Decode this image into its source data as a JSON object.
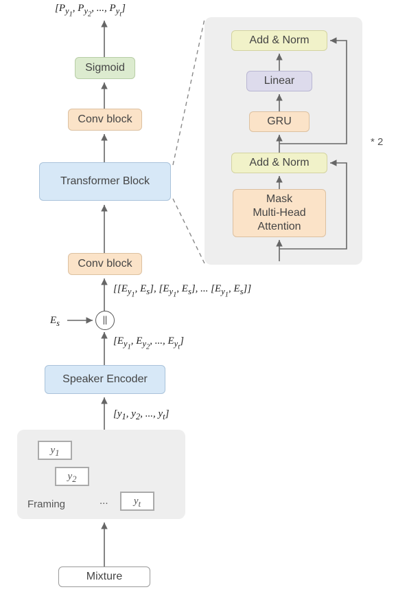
{
  "outputs": "[P_{y_1}, P_{y_2}, ..., P_{y_t}]",
  "blocks": {
    "mixture": "Mixture",
    "framing": "Framing",
    "speaker_encoder": "Speaker Encoder",
    "conv1": "Conv block",
    "transformer": "Transformer Block",
    "conv2": "Conv block",
    "sigmoid": "Sigmoid"
  },
  "frames": {
    "y1": "y_1",
    "y2": "y_2",
    "yt": "y_t",
    "dots": "..."
  },
  "labels": {
    "y_seq": "[y_1, y_2, ..., y_t]",
    "E_seq": "[E_{y_1}, E_{y_2}, ..., E_{y_t}]",
    "Es": "E_s",
    "pair_seq": "[[E_{y_1}, E_s], [E_{y_1}, E_s], ... [E_{y_1}, E_s]]"
  },
  "detail": {
    "mha": "Mask\nMulti-Head\nAttention",
    "addnorm1": "Add & Norm",
    "gru": "GRU",
    "linear": "Linear",
    "addnorm2": "Add & Norm",
    "repeat": "* 2"
  }
}
